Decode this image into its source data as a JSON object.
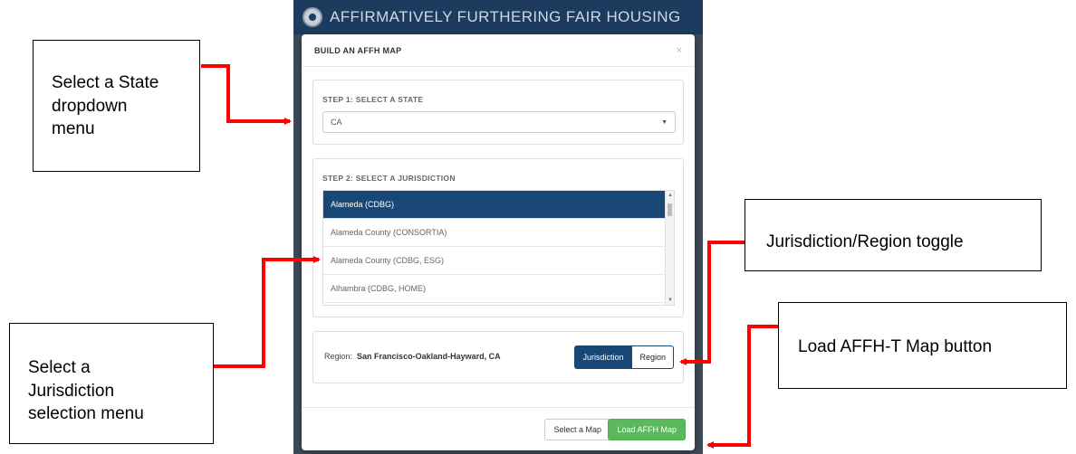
{
  "app": {
    "title": "AFFIRMATIVELY FURTHERING FAIR HOUSING"
  },
  "modal": {
    "title": "BUILD AN AFFH MAP",
    "close": "×",
    "step1": {
      "label": "STEP 1: SELECT A STATE",
      "selected": "CA",
      "caret": "▼"
    },
    "step2": {
      "label": "STEP 2: SELECT A JURISDICTION",
      "items": [
        "Alameda (CDBG)",
        "Alameda County (CONSORTIA)",
        "Alameda County (CDBG, ESG)",
        "Alhambra (CDBG, HOME)"
      ],
      "active_index": 0
    },
    "region": {
      "label": "Region:",
      "value": "San Francisco-Oakland-Hayward, CA",
      "toggle_on": "Jurisdiction",
      "toggle_off": "Region"
    },
    "footer": {
      "select_map": "Select a Map",
      "load_map": "Load AFFH Map"
    }
  },
  "annotations": {
    "state": [
      "Select a State",
      "dropdown",
      "menu"
    ],
    "jurisdiction": [
      "Select a",
      "Jurisdiction",
      "selection menu"
    ],
    "toggle": "Jurisdiction/Region toggle",
    "load": "Load AFFH-T Map button"
  },
  "colors": {
    "header": "#1d3b5e",
    "active": "#1a4876",
    "load_button": "#5cb85c",
    "arrow": "#ff0000"
  }
}
